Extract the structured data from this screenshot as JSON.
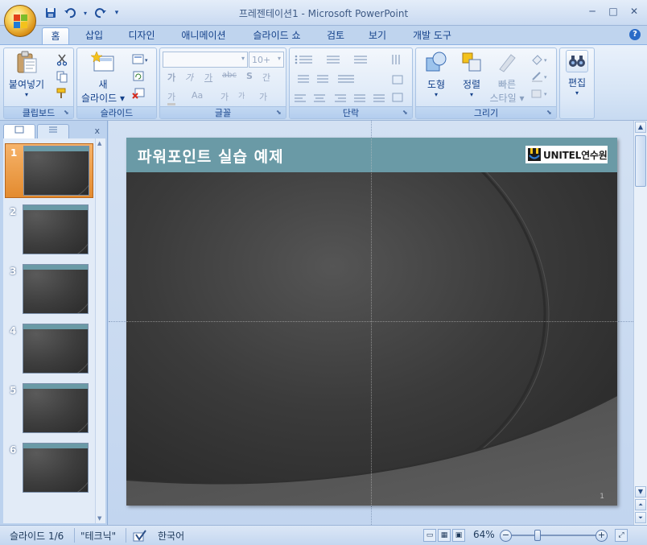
{
  "window": {
    "title": "프레젠테이션1 - Microsoft PowerPoint",
    "controls": [
      "─",
      "□",
      "✕"
    ]
  },
  "quick_access": [
    "save-icon",
    "undo-icon",
    "redo-icon",
    "customize-icon"
  ],
  "tabs": [
    {
      "label": "홈",
      "active": true
    },
    {
      "label": "삽입"
    },
    {
      "label": "디자인"
    },
    {
      "label": "애니메이션"
    },
    {
      "label": "슬라이드 쇼"
    },
    {
      "label": "검토"
    },
    {
      "label": "보기"
    },
    {
      "label": "개발 도구"
    }
  ],
  "ribbon": {
    "clipboard": {
      "label": "클립보드",
      "paste": "붙여넣기"
    },
    "slides": {
      "label": "슬라이드",
      "new_slide_line1": "새",
      "new_slide_line2": "슬라이드"
    },
    "font": {
      "label": "글꼴",
      "size_placeholder": "10+",
      "grow_font": "가",
      "shrink_font": "가",
      "clear_format": "가",
      "strike": "abc",
      "bold": "가",
      "italic": "가",
      "underline": "가",
      "shadow": "S",
      "spacing": "간",
      "case": "Aa",
      "color": "가",
      "grow": "가",
      "shrink2": "가"
    },
    "paragraph": {
      "label": "단락"
    },
    "drawing": {
      "label": "그리기",
      "shapes": "도형",
      "arrange": "정렬",
      "quick_styles_line1": "빠른",
      "quick_styles_line2": "스타일"
    },
    "editing": {
      "label": "편집"
    }
  },
  "slides_pane": {
    "tabs": [
      "slides-tab-icon",
      "outline-tab-icon"
    ],
    "close": "x",
    "thumbnails": [
      {
        "number": "1",
        "selected": true
      },
      {
        "number": "2"
      },
      {
        "number": "3"
      },
      {
        "number": "4"
      },
      {
        "number": "5"
      },
      {
        "number": "6"
      }
    ]
  },
  "slide": {
    "title": "파워포인트 실습 예제",
    "logo_text": "UNITEL연수원",
    "number": "1",
    "title_bar_color": "#6a9aa6"
  },
  "status": {
    "slide_info": "슬라이드 1/6",
    "theme": "\"테크닉\"",
    "language": "한국어",
    "zoom": "64%",
    "zoom_minus": "−",
    "zoom_plus": "+"
  },
  "colors": {
    "ribbon_text": "#15428b",
    "accent_orange": "#e38b2f",
    "slide_bg": "#3b3b3b"
  }
}
